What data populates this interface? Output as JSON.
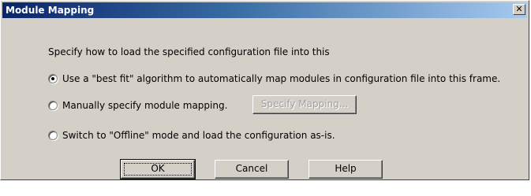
{
  "dialog": {
    "title": "Module Mapping",
    "close_glyph": "✕",
    "prompt": "Specify how to load the specified configuration file into this",
    "options": [
      {
        "label": "Use a \"best fit\" algorithm to automatically map modules in configuration file into this frame.",
        "selected": true
      },
      {
        "label": "Manually specify module mapping.",
        "selected": false
      },
      {
        "label": "Switch to \"Offline\" mode and load the configuration as-is.",
        "selected": false
      }
    ],
    "specify_mapping_label": "Specify Mapping...",
    "buttons": {
      "ok": "OK",
      "cancel": "Cancel",
      "help": "Help"
    }
  }
}
